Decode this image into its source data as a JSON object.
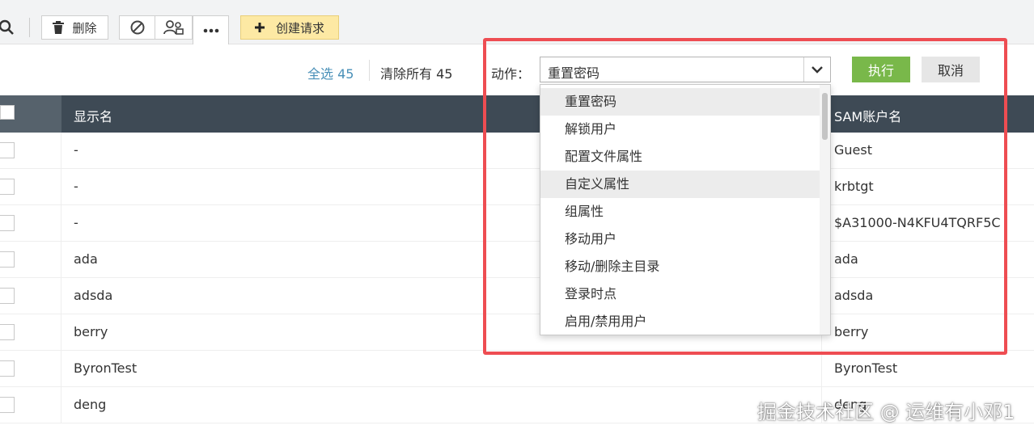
{
  "toolbar": {
    "delete_label": "删除",
    "create_request_label": "创建请求"
  },
  "selection": {
    "select_all": "全选 45",
    "clear_all": "清除所有 45"
  },
  "action": {
    "label": "动作：",
    "selected": "重置密码",
    "options": [
      "重置密码",
      "解锁用户",
      "配置文件属性",
      "自定义属性",
      "组属性",
      "移动用户",
      "移动/删除主目录",
      "登录时点",
      "启用/禁用用户"
    ],
    "execute_label": "执行",
    "cancel_label": "取消"
  },
  "table": {
    "columns": [
      "显示名",
      "SAM账户名"
    ],
    "rows": [
      {
        "name": "-",
        "sam": "Guest"
      },
      {
        "name": "-",
        "sam": "krbtgt"
      },
      {
        "name": "-",
        "sam": "$A31000-N4KFU4TQRF5C"
      },
      {
        "name": "ada",
        "sam": "ada"
      },
      {
        "name": "adsda",
        "sam": "adsda"
      },
      {
        "name": "berry",
        "sam": "berry"
      },
      {
        "name": "ByronTest",
        "sam": "ByronTest"
      },
      {
        "name": "deng",
        "sam": "deng"
      }
    ]
  },
  "watermark": "掘金技术社区 @ 运维有小邓1",
  "colors": {
    "header_bg": "#3e4a55",
    "execute_green": "#79b84a",
    "highlight_red": "#ee4d52",
    "link_blue": "#4a90b8"
  }
}
